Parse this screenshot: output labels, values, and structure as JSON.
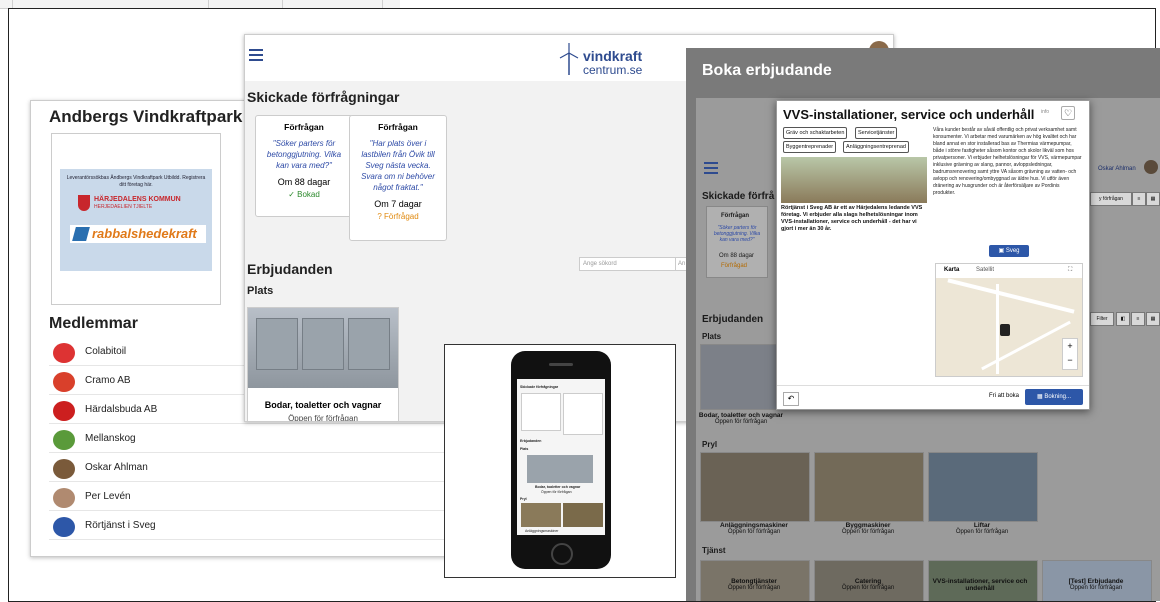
{
  "andbergs": {
    "title": "Andbergs Vindkraftpark",
    "partner_text": "Leverantörssökbas Ändbergs Vindkraftpark Utbildd. Registrera ditt företag här.",
    "kommun_name": "HÄRJEDALENS KOMMUN",
    "kommun_sub": "HERJEDAELIEN TJIELTE",
    "rabbalshede": "rabbalshedekraft",
    "members_title": "Medlemmar",
    "members": [
      {
        "name": "Colabitoil",
        "color": "#d33"
      },
      {
        "name": "Cramo AB",
        "color": "#d9402b"
      },
      {
        "name": "Härdalsbuda AB",
        "color": "#cc1f1f"
      },
      {
        "name": "Mellanskog",
        "color": "#5a9a3a"
      },
      {
        "name": "Oskar Ahlman",
        "color": "#7a5a3a"
      },
      {
        "name": "Per Levén",
        "color": "#b08a70"
      },
      {
        "name": "Rörtjänst i Sveg",
        "color": "#2d57a8"
      }
    ]
  },
  "main": {
    "logo_word1": "vindkraft",
    "logo_word2": "centrum.se",
    "sent_title": "Skickade förfrågningar",
    "requests": [
      {
        "header": "Förfrågan",
        "quote": "\"Söker parters för betonggjutning. Vilka kan vara med?\"",
        "days": "Om 88 dagar",
        "status": "✓ Bokad",
        "kind": "booked"
      },
      {
        "header": "Förfrågan",
        "quote": "\"Har plats över i lastbilen från Övik till Sveg nästa vecka. Svara om ni behöver något fraktat.\"",
        "days": "Om 7 dagar",
        "status": "? Förfrågad",
        "kind": "asked"
      }
    ],
    "offers_title": "Erbjudanden",
    "search_placeholder": "Ange sökord",
    "search_placeholder2": "An",
    "plats_title": "Plats",
    "card_title": "Bodar, toaletter och vagnar",
    "card_status": "Öppen för förfrågan"
  },
  "phone": {
    "sent_title": "Skickade förfrågningar",
    "offers": "Erbjudanden",
    "plats": "Plats",
    "card": "Bodar, toaletter och vagnar",
    "card_status": "Öppen för förfrågan",
    "pryl": "Pryl",
    "anlagg": "Anläggningsmaskiner"
  },
  "booking": {
    "title": "Boka erbjudande",
    "sent_title": "Skickade förfrå",
    "req_header": "Förfrågan",
    "req_quote": "\"Söker parters för betonggjutning. Vilka kan vara med?\"",
    "req_days": "Om 88 dagar",
    "req_status": "Förfrågad",
    "user": "Oskar Ahlman",
    "new_request": "y förfrågan",
    "offers": "Erbjudanden",
    "filter": "Filter",
    "plats": "Plats",
    "plats_card": "Bodar, toaletter och vagnar",
    "plats_status": "Öppen för förfrågan",
    "pryl": "Pryl",
    "pryl_items": [
      {
        "title": "Anläggningsmaskiner",
        "status": "Öppen för förfrågan"
      },
      {
        "title": "Byggmaskiner",
        "status": "Öppen för förfrågan"
      },
      {
        "title": "Liftar",
        "status": "Öppen för förfrågan"
      }
    ],
    "tjanst": "Tjänst",
    "tjanst_items": [
      {
        "title": "Betongtjänster",
        "status": "Öppen för förfrågan"
      },
      {
        "title": "Catering",
        "status": "Öppen för förfrågan"
      },
      {
        "title": "VVS-installationer, service och underhåll",
        "status": ""
      },
      {
        "title": "[Test] Erbjudande",
        "status": "Öppen för förfrågan"
      }
    ]
  },
  "modal": {
    "title": "VVS-installationer, service och underhåll",
    "info": "info",
    "tags": [
      "Gräv och schaktarbeten",
      "Servicetjänster",
      "Byggentreprenader",
      "Anläggningsentreprenad"
    ],
    "short_desc": "Rörtjänst i Sveg AB är ett av Härjedalens ledande VVS företag. Vi erbjuder alla slags helhetslösningar inom VVS-installationer, service och underhåll - det har vi gjort i mer än 30 år.",
    "long_desc": "Våra kunder består av såväl offentlig och privat verksamhet samt konsumenter. Vi arbetar med varumärken av hög kvalitet och har bland annat en stor installerad bas av Thermias värmepumpar, både i större fastigheter såsom kontor och skolor likväl som hos privatpersoner. Vi erbjuder helhetslösningar för VVS, värmepumpar inklusive grävning av slang, pannor, avloppsledningar, badrumsrenovering samt yttre VA såsom grävning av vatten- och avlopp och renovering/ombyggnad av äldre hus. Vi utför även dränering av husgrunder och är återförsäljare av Pordinis produkter.",
    "location": "Sveg",
    "map_tab1": "Karta",
    "map_tab2": "Satellit",
    "free_to_book": "Fri att boka",
    "book_button": "Bokning..."
  }
}
